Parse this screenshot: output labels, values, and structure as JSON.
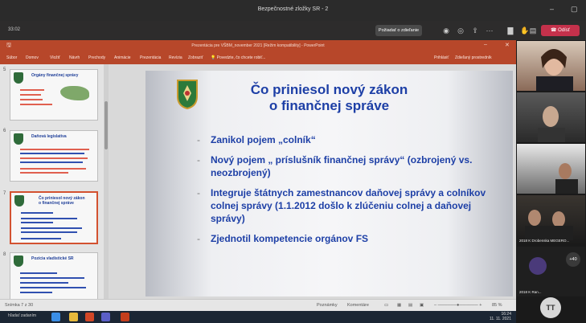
{
  "teams": {
    "window_title": "Bezpečnostné zložky SR - 2",
    "timer": "33:02",
    "raise_hand_label": "Požiadať o zdieľanie",
    "leave_label": "Odísť"
  },
  "ppt": {
    "window_title": "Prezentácia pre VŠBM_november 2021 [Režim kompatibility] - PowerPoint",
    "tabs": [
      "Súbor",
      "Domov",
      "Vložiť",
      "Návrh",
      "Prechody",
      "Animácie",
      "Prezentácia",
      "Revízia",
      "Zobraziť"
    ],
    "search_placeholder": "Povedzte, čo chcete robiť...",
    "right_tabs": [
      "Prihlásiť",
      "Zdieľaný prostredník"
    ]
  },
  "thumbs": [
    {
      "num": "5",
      "title": "Orgány finančnej správy",
      "selected": false
    },
    {
      "num": "6",
      "title": "Daňová legislatíva",
      "selected": false
    },
    {
      "num": "7",
      "title": "Čo priniesol nový zákon o finančnej správe",
      "selected": true
    },
    {
      "num": "8",
      "title": "Pozícia vladistické SR",
      "selected": false
    }
  ],
  "slide": {
    "title_line1": "Čo priniesol nový zákon",
    "title_line2": "o finančnej správe",
    "bullets": [
      "Zanikol pojem „colník“",
      "Nový pojem „ príslušník finančnej správy“ (ozbrojený vs. neozbrojený)",
      "Integruje štátnych zamestnancov daňovej správy a colníkov colnej správy (1.1.2012 došlo k zlúčeniu colnej a daňovej správy)",
      "Zjednotil kompetencie orgánov FS"
    ]
  },
  "status": {
    "slide_counter": "Snímka 7 z 30",
    "notes": "Poznámky",
    "comments": "Komentáre",
    "zoom": "85 %"
  },
  "taskbar": {
    "search": "hľadať zadaním",
    "time": "16:24",
    "date": "11. 11. 2021"
  },
  "participants": {
    "tile_names": [
      "2018 K Drobenska MEGERO...",
      "2018 K Ran..."
    ],
    "overflow_count": "+40",
    "self_initials": "TT"
  },
  "colors": {
    "ppt_accent": "#b7472a",
    "slide_title": "#1d3fa6",
    "leave_red": "#c4314b"
  }
}
